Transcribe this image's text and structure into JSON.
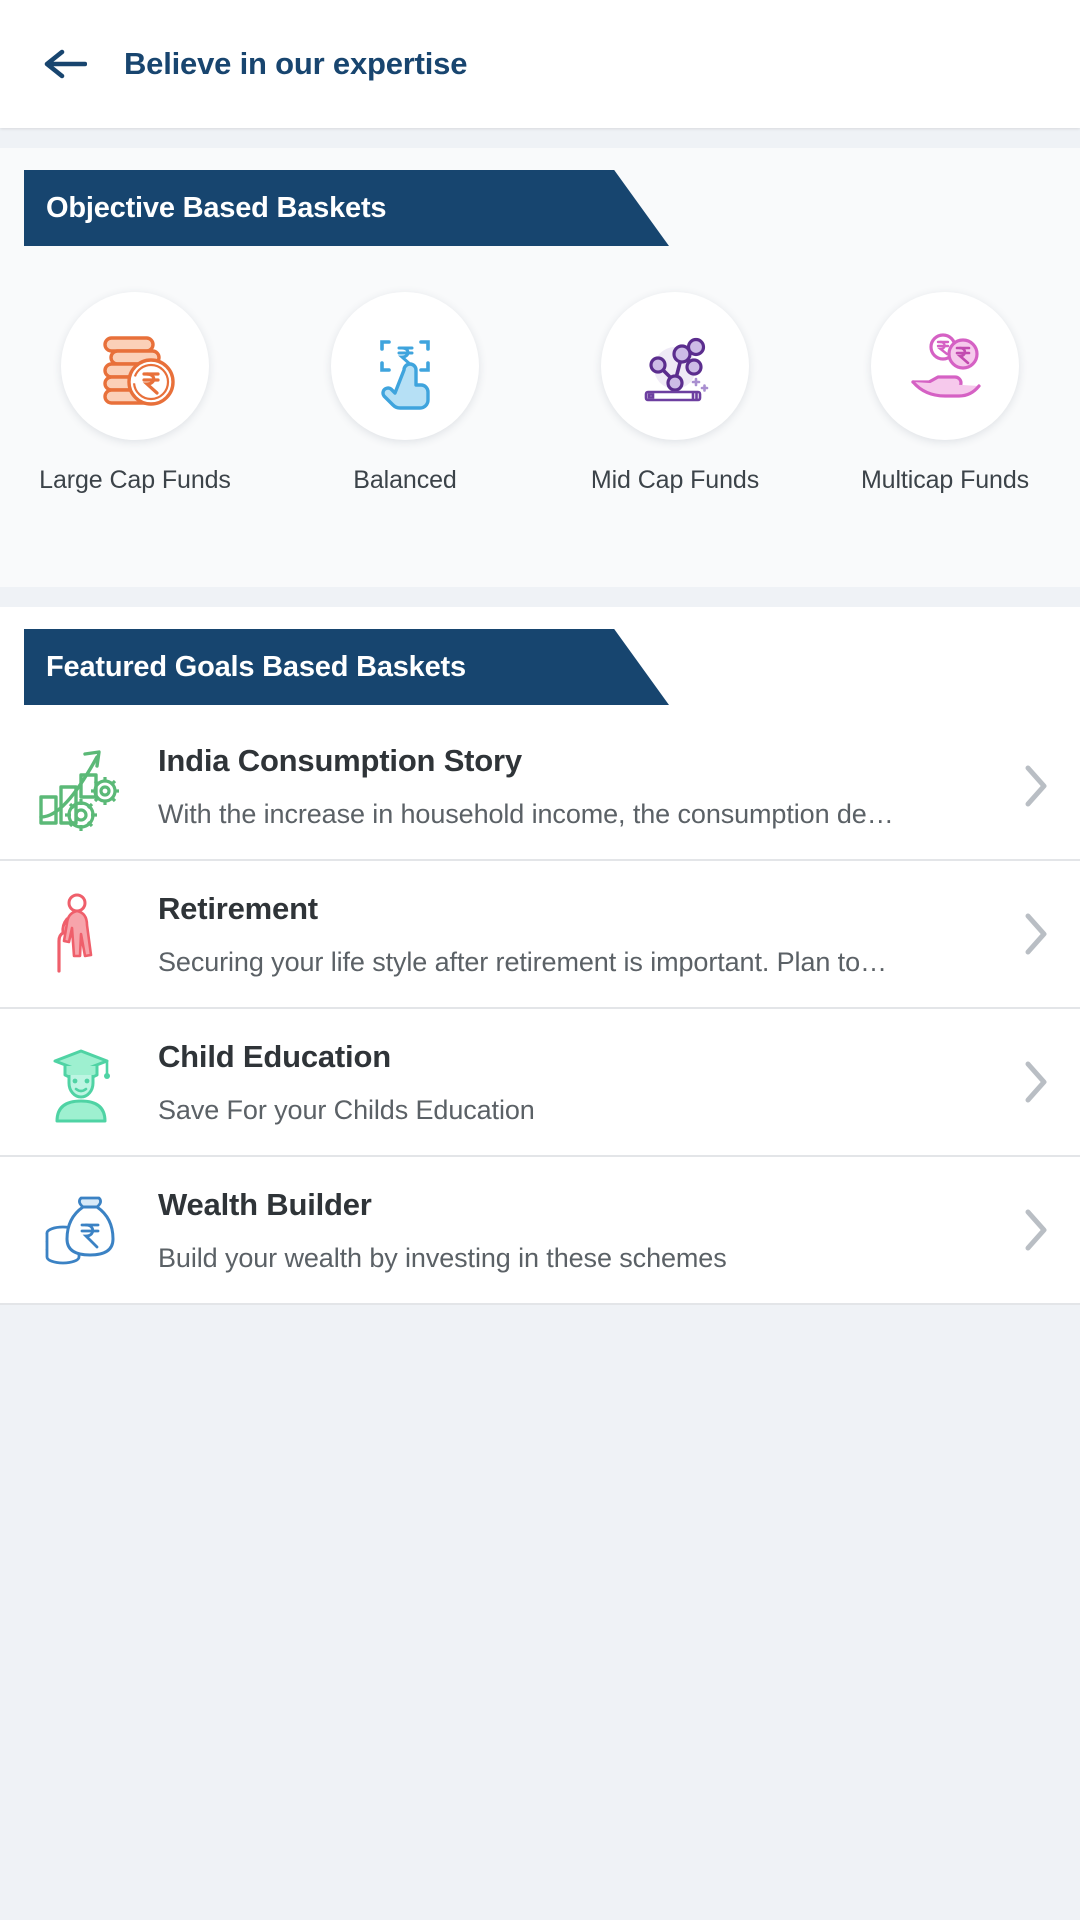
{
  "header": {
    "back_icon": "arrow-left-icon",
    "title": "Believe in our expertise"
  },
  "objective_section": {
    "banner_title": "Objective Based Baskets",
    "items": [
      {
        "label": "Large Cap Funds",
        "icon": "coin-stack-rupee-icon",
        "color": "#e8703a"
      },
      {
        "label": "Balanced",
        "icon": "tap-rupee-scan-icon",
        "color": "#4aa8dd"
      },
      {
        "label": "Mid Cap Funds",
        "icon": "network-nodes-icon",
        "color": "#6d3fa0"
      },
      {
        "label": "Multicap Funds",
        "icon": "hand-rupee-coins-icon",
        "color": "#d561c4"
      }
    ]
  },
  "goals_section": {
    "banner_title": "Featured Goals Based Baskets",
    "chevron_icon": "chevron-right-icon",
    "items": [
      {
        "title": "India Consumption Story",
        "desc": "With the increase in household income, the consumption de…",
        "icon": "growth-chart-gears-icon",
        "color": "#5bb977"
      },
      {
        "title": "Retirement",
        "desc": "Securing your life style after retirement is important. Plan to…",
        "icon": "elderly-person-cane-icon",
        "color": "#ef5f6b"
      },
      {
        "title": "Child Education",
        "desc": "Save For your Childs Education",
        "icon": "graduate-student-icon",
        "color": "#5fdcae"
      },
      {
        "title": "Wealth Builder",
        "desc": "Build your wealth by investing in these schemes",
        "icon": "money-bag-coins-icon",
        "color": "#3b82c4"
      }
    ]
  },
  "theme": {
    "banner_blue": "#17456f",
    "title_blue": "#18456f",
    "page_bg": "#eff2f6"
  }
}
